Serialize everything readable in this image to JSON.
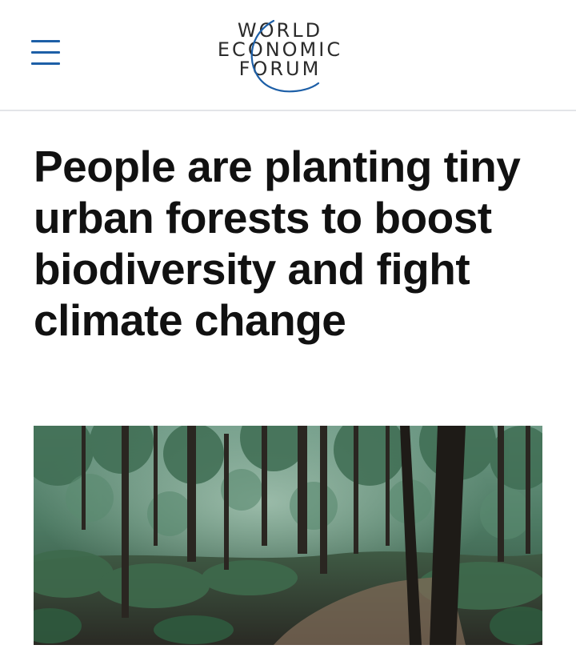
{
  "header": {
    "menu_icon": "hamburger-menu-icon",
    "logo": {
      "line1": "WORLD",
      "line2": "ECONOMIC",
      "line3": "FORUM",
      "accent_color": "#1d5fa7"
    }
  },
  "article": {
    "title": "People are planting tiny urban forests to boost biodiversity and fight climate change",
    "hero_image": "forest-photo"
  },
  "colors": {
    "menu_icon": "#1d5fa7",
    "title_text": "#111111",
    "divider": "#e3e5e8"
  }
}
